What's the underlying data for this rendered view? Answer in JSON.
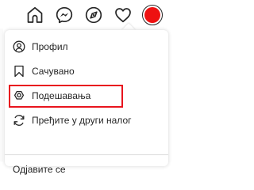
{
  "nav": {
    "icons": [
      "home-icon",
      "messenger-icon",
      "explore-icon",
      "activity-heart-icon",
      "profile-avatar"
    ],
    "avatar_color": "#ee1111"
  },
  "menu": {
    "items": [
      {
        "icon": "profile-icon",
        "label": "Профил"
      },
      {
        "icon": "bookmark-icon",
        "label": "Сачувано"
      },
      {
        "icon": "settings-icon",
        "label": "Подешавања"
      },
      {
        "icon": "switch-account-icon",
        "label": "Пређите у други налог"
      }
    ],
    "logout_label": "Одјавите се"
  },
  "highlight": {
    "target": "settings-menu-item",
    "color": "#e8141e"
  }
}
